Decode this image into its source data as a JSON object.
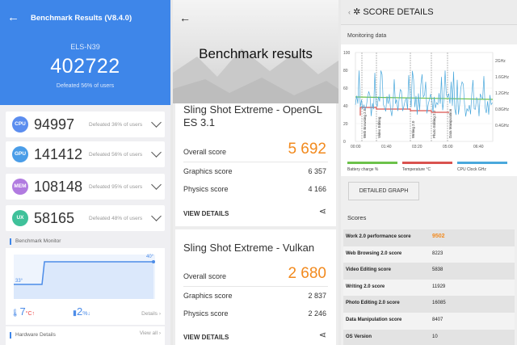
{
  "antutu": {
    "title": "Benchmark Results (V8.4.0)",
    "model": "ELS-N39",
    "total": "402722",
    "defeated": "Defeated 56% of users",
    "rows": [
      {
        "badge": "CPU",
        "score": "94997",
        "defeated": "Defeated 36% of users",
        "color": "#5b8def"
      },
      {
        "badge": "GPU",
        "score": "141412",
        "defeated": "Defeated 56% of users",
        "color": "#4a9de8"
      },
      {
        "badge": "MEM",
        "score": "108148",
        "defeated": "Defeated 95% of users",
        "color": "#b17be0"
      },
      {
        "badge": "UX",
        "score": "58165",
        "defeated": "Defeated 48% of users",
        "color": "#3fc19a"
      }
    ],
    "monitor_label": "Benchmark Monitor",
    "temp_start": "33°",
    "temp_end": "40°",
    "temp_delta": "7",
    "temp_unit": "°C",
    "temp_arrow": "↑",
    "battery_delta": "2",
    "battery_unit": "%↓",
    "details": "Details",
    "hardware_label": "Hardware Details",
    "view_all": "View all",
    "accent": "#3e86e9"
  },
  "threedmark": {
    "title": "Benchmark results",
    "tests": [
      {
        "name": "Sling Shot Extreme - OpenGL ES 3.1",
        "overall_label": "Overall score",
        "overall": "5 692",
        "graphics_label": "Graphics score",
        "graphics": "6 357",
        "physics_label": "Physics score",
        "physics": "4 166",
        "view": "VIEW DETAILS"
      },
      {
        "name": "Sling Shot Extreme - Vulkan",
        "overall_label": "Overall score",
        "overall": "2 680",
        "graphics_label": "Graphics score",
        "graphics": "2 837",
        "physics_label": "Physics score",
        "physics": "2 246",
        "view": "VIEW DETAILS"
      }
    ],
    "accent": "#f28a1e"
  },
  "pcmark": {
    "title": "SCORE DETAILS",
    "monitoring": "Monitoring data",
    "graph_button": "DETAILED GRAPH",
    "scores_label": "Scores",
    "legend": [
      {
        "label": "Battery charge %",
        "color": "#6cc24a"
      },
      {
        "label": "Temperature °C",
        "color": "#d9534f"
      },
      {
        "label": "CPU Clock GHz",
        "color": "#4aa8dc"
      }
    ],
    "y_left": [
      "100",
      "80",
      "60",
      "40",
      "20",
      "0"
    ],
    "y_right": [
      "2GHz",
      "1.6GHz",
      "1.2GHz",
      "0.8GHz",
      "0.4GHz"
    ],
    "x_ticks": [
      "00:00",
      "01:40",
      "03:20",
      "05:00",
      "06:40"
    ],
    "phases": [
      "Web Browsing 2.0",
      "Video Editing",
      "Writing 2.0",
      "Photo Editing 2.0",
      "Data Manipulation"
    ],
    "table": [
      {
        "name": "Work 2.0 performance score",
        "value": "9502"
      },
      {
        "name": "Web Browsing 2.0 score",
        "value": "8223"
      },
      {
        "name": "Video Editing score",
        "value": "5838"
      },
      {
        "name": "Writing 2.0 score",
        "value": "11929"
      },
      {
        "name": "Photo Editing 2.0 score",
        "value": "16085"
      },
      {
        "name": "Data Manipulation score",
        "value": "8407"
      },
      {
        "name": "OS Version",
        "value": "10"
      }
    ]
  }
}
